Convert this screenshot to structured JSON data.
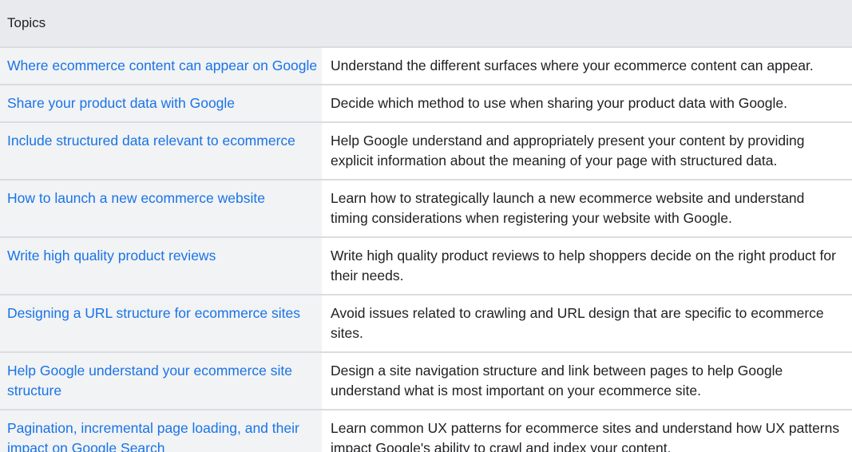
{
  "table": {
    "header": "Topics",
    "rows": [
      {
        "topic": "Where ecommerce content can appear on Google",
        "description": "Understand the different surfaces where your ecommerce content can appear."
      },
      {
        "topic": "Share your product data with Google",
        "description": "Decide which method to use when sharing your product data with Google."
      },
      {
        "topic": "Include structured data relevant to ecommerce",
        "description": "Help Google understand and appropriately present your content by providing explicit information about the meaning of your page with structured data."
      },
      {
        "topic": "How to launch a new ecommerce website",
        "description": "Learn how to strategically launch a new ecommerce website and understand timing considerations when registering your website with Google."
      },
      {
        "topic": "Write high quality product reviews",
        "description": "Write high quality product reviews to help shoppers decide on the right product for their needs."
      },
      {
        "topic": "Designing a URL structure for ecommerce sites",
        "description": "Avoid issues related to crawling and URL design that are specific to ecommerce sites."
      },
      {
        "topic": "Help Google understand your ecommerce site structure",
        "description": "Design a site navigation structure and link between pages to help Google understand what is most important on your ecommerce site."
      },
      {
        "topic": "Pagination, incremental page loading, and their impact on Google Search",
        "description": "Learn common UX patterns for ecommerce sites and understand how UX patterns impact Google's ability to crawl and index your content."
      }
    ]
  },
  "colors": {
    "link": "#1a73e8",
    "header_bg": "#e8eaed",
    "topic_bg": "#f1f3f4",
    "border": "#dadce0",
    "text": "#202124"
  }
}
